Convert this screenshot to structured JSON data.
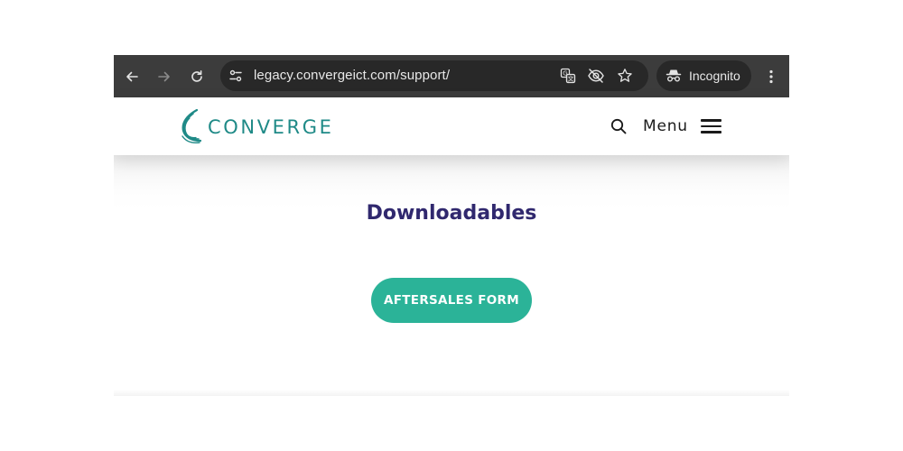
{
  "browser": {
    "url": "legacy.convergeict.com/support/",
    "incognito_label": "Incognito",
    "icons": {
      "back": "arrow-left-icon",
      "forward": "arrow-right-icon",
      "reload": "reload-icon",
      "site_info": "tune-icon",
      "translate": "translate-icon",
      "tracking": "eye-off-icon",
      "bookmark": "star-icon",
      "incognito": "incognito-icon",
      "menu": "kebab-menu-icon"
    },
    "colors": {
      "toolbar": "#3c3c3c",
      "omnibox": "#282828",
      "text": "#e8e8e8"
    }
  },
  "site": {
    "logo_text": "CONVERGE",
    "menu_label": "Menu",
    "colors": {
      "brand_teal": "#1f8a87",
      "heading": "#30286e",
      "button": "#2bb398"
    }
  },
  "main": {
    "title": "Downloadables",
    "button_label": "AFTERSALES FORM"
  }
}
